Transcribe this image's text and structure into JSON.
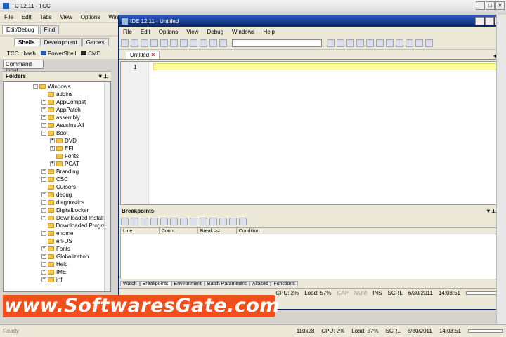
{
  "tcc": {
    "title": "TC 12.11 - TCC",
    "menu": [
      "File",
      "Edit",
      "Tabs",
      "View",
      "Options",
      "Window"
    ],
    "tabs": [
      "Edit/Debug",
      "Find"
    ],
    "subtabs": [
      "Shells",
      "Development",
      "Games"
    ],
    "shells": [
      "TCC",
      "bash",
      "PowerShell",
      "CMD"
    ],
    "command_input": "Command Input",
    "folders_title": "Folders",
    "tree": [
      {
        "label": "Windows",
        "exp": "-",
        "indent": 1
      },
      {
        "label": "addins",
        "exp": "",
        "indent": 2
      },
      {
        "label": "AppCompat",
        "exp": "+",
        "indent": 2
      },
      {
        "label": "AppPatch",
        "exp": "+",
        "indent": 2
      },
      {
        "label": "assembly",
        "exp": "+",
        "indent": 2
      },
      {
        "label": "AsusInstAll",
        "exp": "+",
        "indent": 2
      },
      {
        "label": "Boot",
        "exp": "-",
        "indent": 2
      },
      {
        "label": "DVD",
        "exp": "+",
        "indent": 3
      },
      {
        "label": "EFI",
        "exp": "+",
        "indent": 3
      },
      {
        "label": "Fonts",
        "exp": "",
        "indent": 3
      },
      {
        "label": "PCAT",
        "exp": "+",
        "indent": 3
      },
      {
        "label": "Branding",
        "exp": "+",
        "indent": 2
      },
      {
        "label": "CSC",
        "exp": "+",
        "indent": 2
      },
      {
        "label": "Cursors",
        "exp": "",
        "indent": 2
      },
      {
        "label": "debug",
        "exp": "+",
        "indent": 2
      },
      {
        "label": "diagnostics",
        "exp": "+",
        "indent": 2
      },
      {
        "label": "DigitalLocker",
        "exp": "+",
        "indent": 2
      },
      {
        "label": "Downloaded Installat",
        "exp": "+",
        "indent": 2
      },
      {
        "label": "Downloaded Program",
        "exp": "",
        "indent": 2
      },
      {
        "label": "ehome",
        "exp": "+",
        "indent": 2
      },
      {
        "label": "en-US",
        "exp": "",
        "indent": 2
      },
      {
        "label": "Fonts",
        "exp": "+",
        "indent": 2
      },
      {
        "label": "Globalization",
        "exp": "+",
        "indent": 2
      },
      {
        "label": "Help",
        "exp": "+",
        "indent": 2
      },
      {
        "label": "IME",
        "exp": "+",
        "indent": 2
      },
      {
        "label": "inf",
        "exp": "+",
        "indent": 2
      }
    ],
    "status": {
      "ready": "Ready",
      "size": "110x28",
      "cpu": "CPU: 2%",
      "load": "Load: 57%",
      "scrl": "SCRL",
      "date": "6/30/2011",
      "time": "14:03:51"
    }
  },
  "ide": {
    "title": "IDE 12.11 - Untitled",
    "menu": [
      "File",
      "Edit",
      "Options",
      "View",
      "Debug",
      "Windows",
      "Help"
    ],
    "doc_tab": "Untitled",
    "line_number": "1",
    "breakpoints_title": "Breakpoints",
    "bp_columns": [
      "Line",
      "Count",
      "Break >=",
      "Condition"
    ],
    "bottom_tabs": [
      "Watch",
      "Breakpoints",
      "Environment",
      "Batch Parameters",
      "Aliases",
      "Functions"
    ],
    "status": {
      "cpu": "CPU: 2%",
      "load": "Load: 57%",
      "cap": "CAP",
      "num": "NUM",
      "ins": "INS",
      "scrl": "SCRL",
      "date": "6/30/2011",
      "time": "14:03:51"
    }
  },
  "watermark": "www.SoftwaresGate.com",
  "colors": {
    "ide_title": "#0a246a",
    "current_line": "#ffff99",
    "watermark_bg": "#f04e1a",
    "watermark_text": "#ffffff"
  }
}
